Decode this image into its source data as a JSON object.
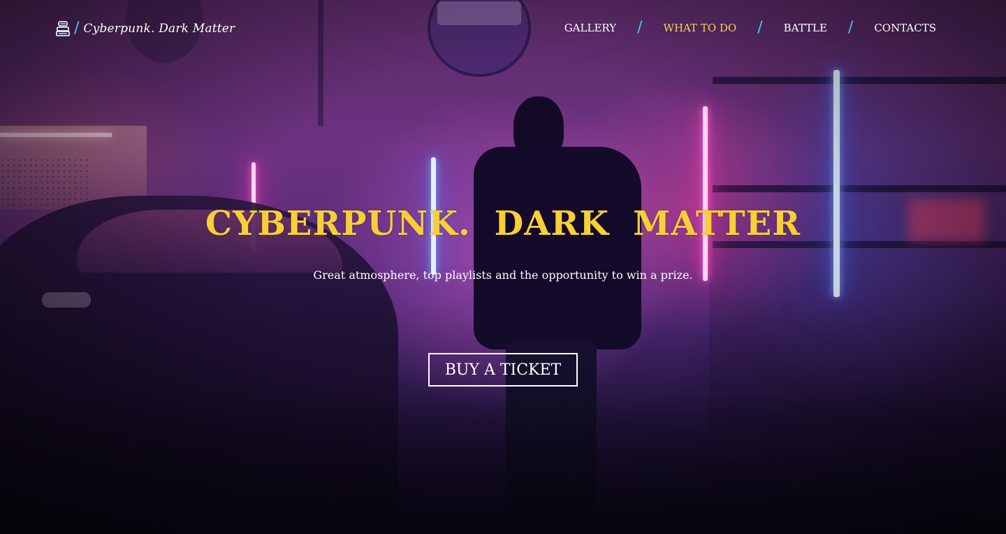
{
  "header": {
    "logo_text": "Cyberpunk. Dark Matter",
    "logo_separator": "/",
    "nav": [
      {
        "label": "GALLERY",
        "active": false
      },
      {
        "label": "WHAT TO DO",
        "active": true
      },
      {
        "label": "BATTLE",
        "active": false
      },
      {
        "label": "CONTACTS",
        "active": false
      }
    ],
    "nav_separator": "/"
  },
  "hero": {
    "title_part1": "Cyberpunk.",
    "title_part2": "Dark",
    "title_part3": "Matter",
    "subtitle": "Great atmosphere, top playlists and the opportunity to win a prize.",
    "cta_label": "BUY A TICKET"
  },
  "colors": {
    "accent_yellow": "#f8cf35",
    "nav_active": "#f3d257",
    "separator_cyan": "#3fc8ff",
    "text_white": "#ffffff"
  },
  "icons": {
    "logo": "dj-console-icon"
  }
}
